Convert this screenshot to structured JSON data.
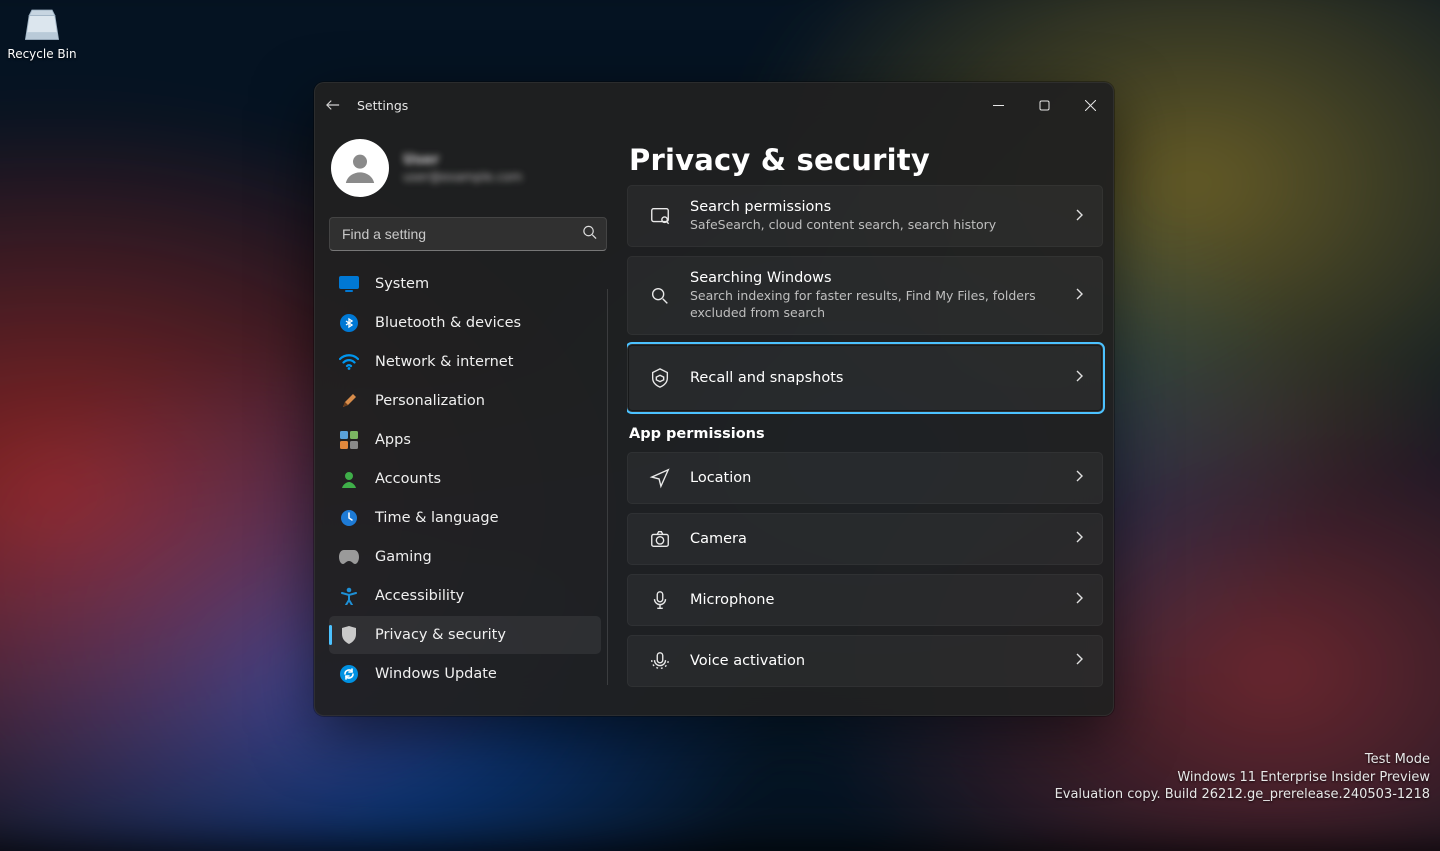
{
  "desktop": {
    "recycle_bin_label": "Recycle Bin",
    "watermark": {
      "line1": "Test Mode",
      "line2": "Windows 11 Enterprise Insider Preview",
      "line3": "Evaluation copy. Build 26212.ge_prerelease.240503-1218"
    }
  },
  "window": {
    "title": "Settings",
    "account": {
      "name": "User",
      "email": "user@example.com"
    },
    "search_placeholder": "Find a setting",
    "sidebar": {
      "items": [
        {
          "label": "System"
        },
        {
          "label": "Bluetooth & devices"
        },
        {
          "label": "Network & internet"
        },
        {
          "label": "Personalization"
        },
        {
          "label": "Apps"
        },
        {
          "label": "Accounts"
        },
        {
          "label": "Time & language"
        },
        {
          "label": "Gaming"
        },
        {
          "label": "Accessibility"
        },
        {
          "label": "Privacy & security"
        },
        {
          "label": "Windows Update"
        }
      ],
      "active_index": 9
    },
    "page": {
      "title": "Privacy & security",
      "section_header": "App permissions",
      "items": [
        {
          "title": "Search permissions",
          "sub": "SafeSearch, cloud content search, search history"
        },
        {
          "title": "Searching Windows",
          "sub": "Search indexing for faster results, Find My Files, folders excluded from search"
        },
        {
          "title": "Recall and snapshots",
          "highlight": true
        },
        {
          "title": "Location"
        },
        {
          "title": "Camera"
        },
        {
          "title": "Microphone"
        },
        {
          "title": "Voice activation"
        }
      ]
    }
  }
}
